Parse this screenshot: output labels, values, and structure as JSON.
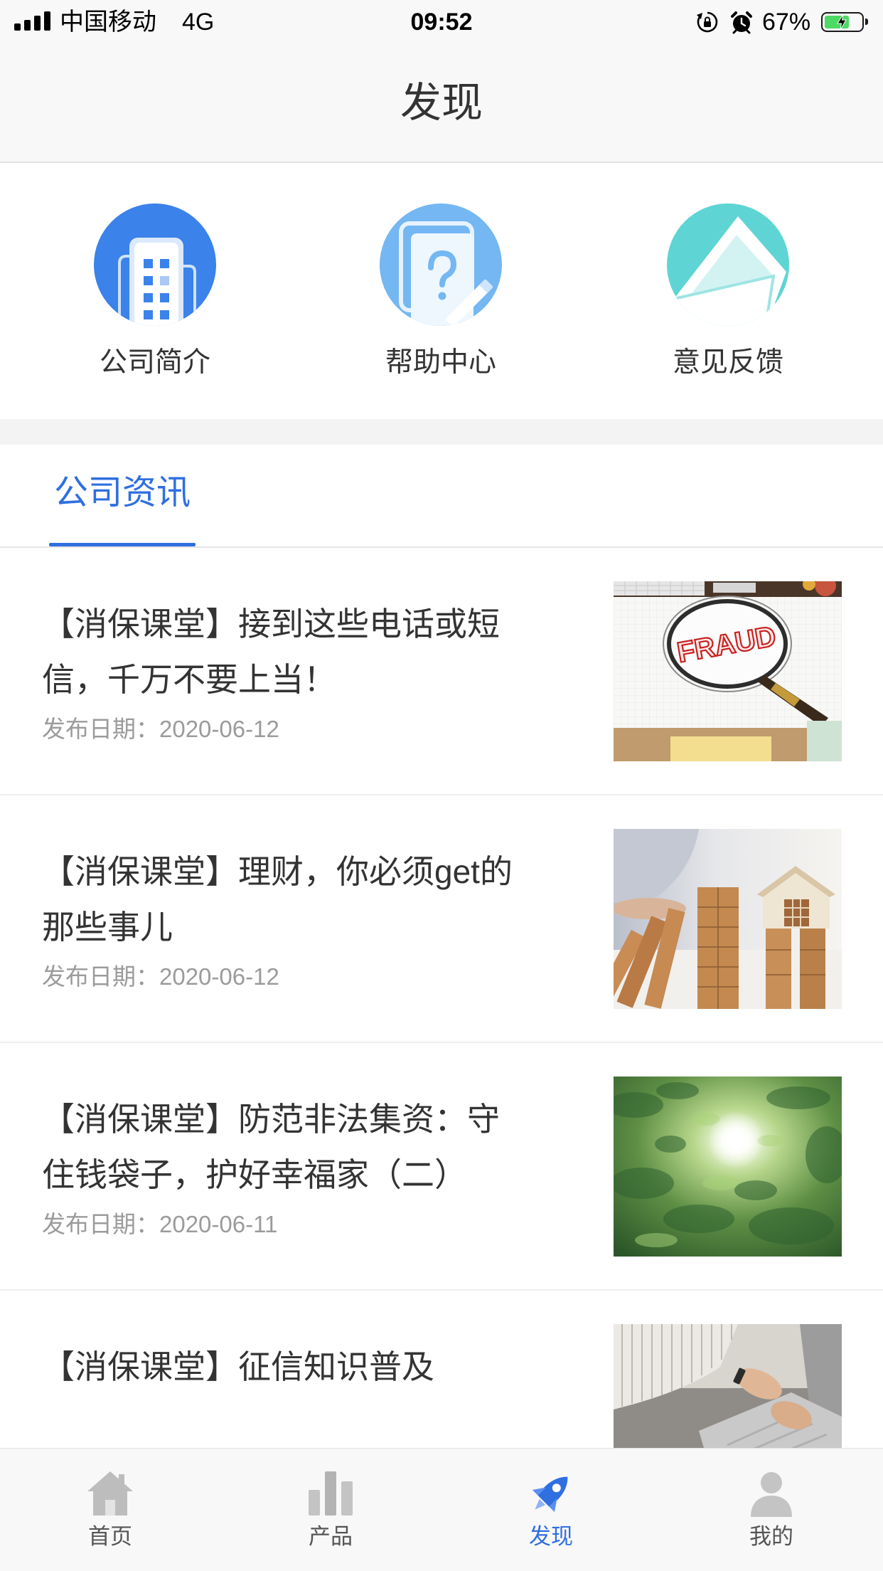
{
  "status_bar": {
    "carrier": "中国移动",
    "network": "4G",
    "time": "09:52",
    "battery_text": "67%",
    "battery_level": 0.67,
    "icons": [
      "signal-strength-icon",
      "rotation-lock-icon",
      "alarm-icon",
      "battery-charging-icon"
    ]
  },
  "nav": {
    "title": "发现"
  },
  "quick_links": [
    {
      "label": "公司简介",
      "icon": "building-icon",
      "color": "#3b82ea"
    },
    {
      "label": "帮助中心",
      "icon": "help-document-icon",
      "color": "#74b7f2"
    },
    {
      "label": "意见反馈",
      "icon": "envelope-icon",
      "color": "#5fd4d4"
    }
  ],
  "tabs": [
    {
      "label": "公司资讯",
      "active": true
    }
  ],
  "news": [
    {
      "title_lines": [
        "【消保课堂】接到这些电话或短",
        "信，千万不要上当！"
      ],
      "date": "发布日期：2020-06-12",
      "photo_text": "FRAUD"
    },
    {
      "title_lines": [
        "【消保课堂】理财，你必须get的",
        "那些事儿"
      ],
      "date": "发布日期：2020-06-12"
    },
    {
      "title_lines": [
        "【消保课堂】防范非法集资：守",
        "住钱袋子，护好幸福家（二）"
      ],
      "date": "发布日期：2020-06-11"
    },
    {
      "title_lines": [
        "【消保课堂】征信知识普及"
      ]
    }
  ],
  "tab_bar": [
    {
      "label": "首页",
      "icon": "home-icon",
      "active": false
    },
    {
      "label": "产品",
      "icon": "bar-chart-icon",
      "active": false
    },
    {
      "label": "发现",
      "icon": "rocket-icon",
      "active": true
    },
    {
      "label": "我的",
      "icon": "user-icon",
      "active": false
    }
  ],
  "colors": {
    "accent": "#2f6fe0",
    "text": "#333333",
    "date": "#9b9b9b",
    "separator_gray": "#f3f3f3",
    "battery": "#4cd964",
    "tab_inactive_icon": "#bdbdbd"
  }
}
